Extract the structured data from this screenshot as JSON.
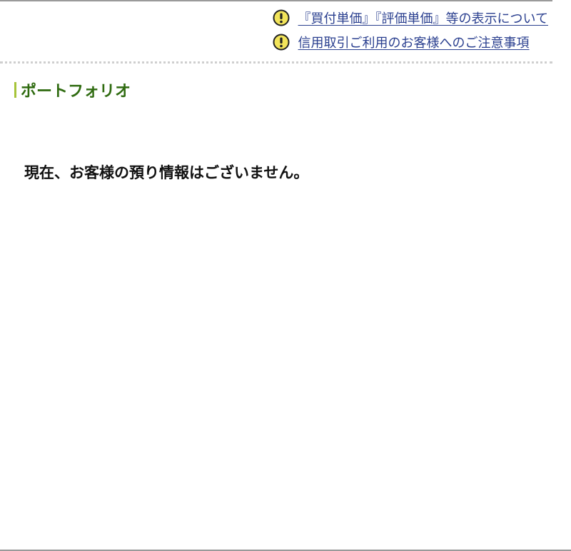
{
  "notices": [
    {
      "icon": "warning-icon",
      "label": "『買付単価』『評価単価』等の表示について"
    },
    {
      "icon": "warning-icon",
      "label": "信用取引ご利用のお客様へのご注意事項"
    }
  ],
  "section": {
    "title": "ポートフォリオ",
    "accent_color": "#a6c43a",
    "title_color": "#2f6b10"
  },
  "message": "現在、お客様の預り情報はございません。",
  "colors": {
    "link": "#2a3f8f",
    "icon_fill": "#f2e45a"
  }
}
